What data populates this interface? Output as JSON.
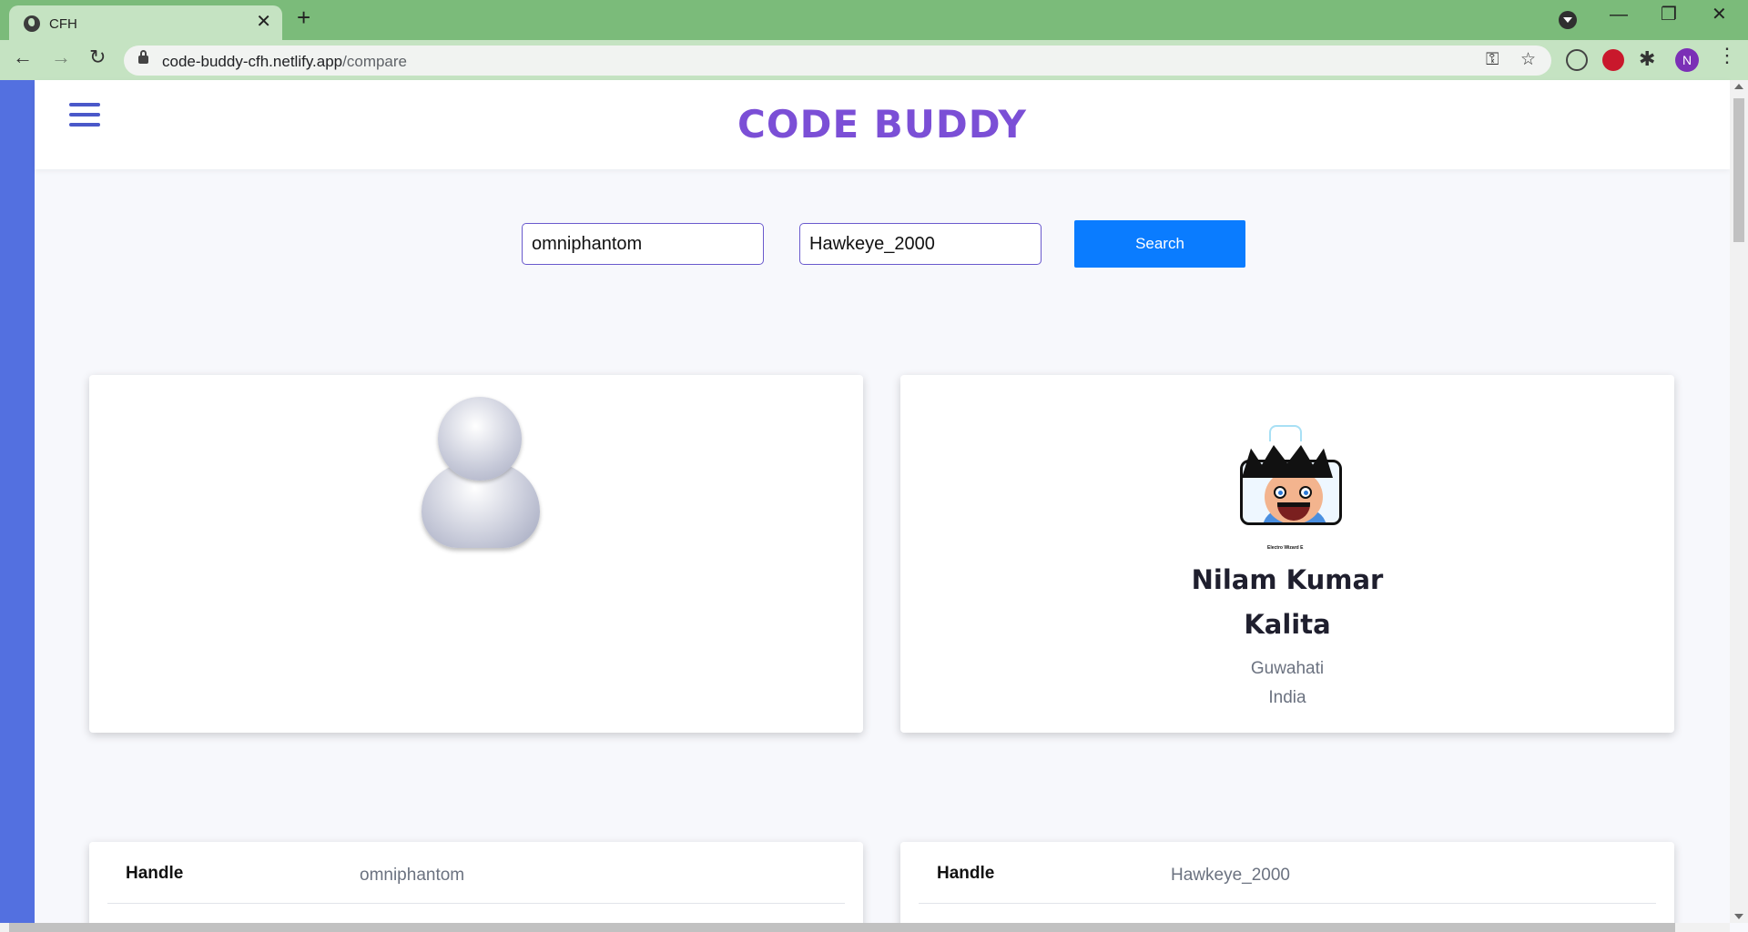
{
  "browser": {
    "tab_title": "CFH",
    "tab_close": "✕",
    "new_tab": "+",
    "url_host": "code-buddy-cfh.netlify.app",
    "url_path": "/compare",
    "profile_initial": "N"
  },
  "header": {
    "brand": "CODE BUDDY"
  },
  "search": {
    "handle1": "omniphantom",
    "handle2": "Hawkeye_2000",
    "button_label": "Search"
  },
  "profiles": [
    {
      "avatar": "default-user-avatar",
      "name_line1": "",
      "name_line2": "",
      "city": "",
      "country": ""
    },
    {
      "avatar": "electro-wizard-avatar",
      "avatar_caption": "Electro Wizard E",
      "name_line1": "Nilam Kumar",
      "name_line2": "Kalita",
      "city": "Guwahati",
      "country": "India"
    }
  ],
  "info": [
    {
      "label": "Handle",
      "value": "omniphantom"
    },
    {
      "label": "Handle",
      "value": "Hawkeye_2000"
    }
  ],
  "colors": {
    "accent": "#5370e0",
    "brand": "#7b4fd6",
    "button": "#0a7cff",
    "chrome": "#7bbb7a"
  }
}
